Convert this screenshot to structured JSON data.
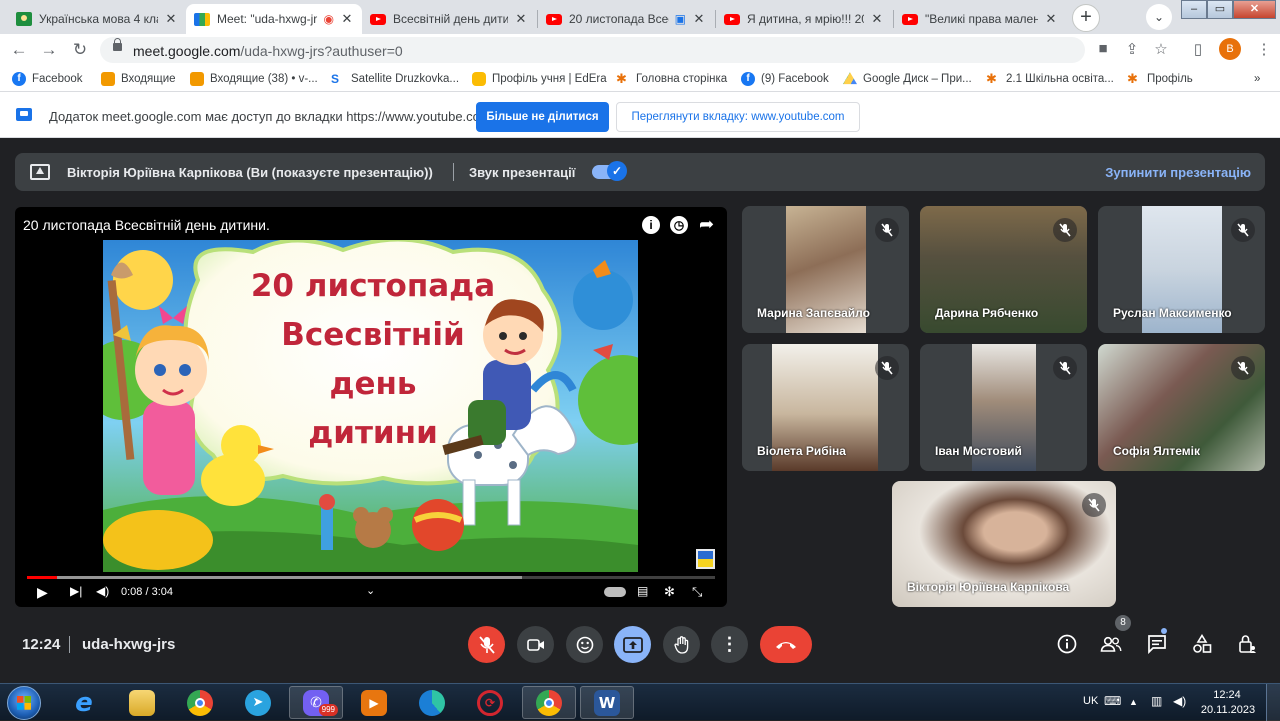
{
  "browser": {
    "tabs": [
      {
        "title": "Українська мова 4 кла",
        "favicon": "classroom-icon",
        "active": false
      },
      {
        "title": "Meet: \"uda-hxwg-jr",
        "favicon": "meet-icon",
        "active": true
      },
      {
        "title": "Всесвітній день дитин",
        "favicon": "youtube-icon",
        "active": false
      },
      {
        "title": "20 листопада Всес",
        "favicon": "youtube-icon",
        "active": false
      },
      {
        "title": "Я дитина, я мрію!!! 20",
        "favicon": "youtube-icon",
        "active": false
      },
      {
        "title": "\"Великі права малень",
        "favicon": "youtube-icon",
        "active": false
      }
    ],
    "new_tab": "+",
    "url_host": "meet.google.com",
    "url_path": "/uda-hxwg-jrs?authuser=0",
    "profile_initial": "B",
    "bookmarks": [
      {
        "label": "Facebook",
        "icon": "facebook-icon"
      },
      {
        "label": "Входящие",
        "icon": "ukrnet-icon"
      },
      {
        "label": "Входящие (38) • v-...",
        "icon": "ukrnet-icon"
      },
      {
        "label": "Satellite Druzkovka...",
        "icon": "satellite-icon"
      },
      {
        "label": "Профіль учня | EdEra",
        "icon": "edera-icon"
      },
      {
        "label": "Головна сторінка",
        "icon": "school-icon"
      },
      {
        "label": "(9) Facebook",
        "icon": "facebook-icon"
      },
      {
        "label": "Google Диск – При...",
        "icon": "drive-icon"
      },
      {
        "label": "2.1 Шкільна освіта...",
        "icon": "school-icon"
      },
      {
        "label": "Профіль",
        "icon": "school-icon"
      }
    ],
    "more_bookmarks": "»"
  },
  "infobar": {
    "message": "Додаток meet.google.com має доступ до вкладки https://www.youtube.com",
    "stop_sharing": "Більше не ділитися",
    "view_tab": "Переглянути вкладку: www.youtube.com"
  },
  "presenting": {
    "presenter": "Вікторія Юріївна Карпікова (Ви (показуєте презентацію))",
    "audio_label": "Звук презентації",
    "audio_on": true,
    "stop_label": "Зупинити презентацію"
  },
  "video": {
    "title": "20 листопада Всесвітній день дитини.",
    "poster_heading": [
      "20 листопада",
      "Всесвітній",
      "день",
      "дитини"
    ],
    "time_current": "0:08",
    "time_total": "3:04",
    "played_fraction": 0.043,
    "buffered_fraction": 0.72
  },
  "participants": [
    {
      "name": "Марина Запєвайло",
      "muted": true
    },
    {
      "name": "Дарина Рябченко",
      "muted": true
    },
    {
      "name": "Руслан Максименко",
      "muted": true
    },
    {
      "name": "Віолета Рибіна",
      "muted": true
    },
    {
      "name": "Іван Мостовий",
      "muted": true
    },
    {
      "name": "Софія Ялтемік",
      "muted": true
    },
    {
      "name": "Вікторія Юріївна Карпікова",
      "muted": true
    }
  ],
  "meeting": {
    "time": "12:24",
    "code": "uda-hxwg-jrs",
    "people_count": "8"
  },
  "taskbar": {
    "apps": [
      {
        "name": "internet-explorer",
        "label": "e"
      },
      {
        "name": "file-explorer",
        "label": ""
      },
      {
        "name": "chrome",
        "label": ""
      },
      {
        "name": "telegram",
        "label": ""
      },
      {
        "name": "viber",
        "label": "",
        "badge": "999"
      },
      {
        "name": "media-player",
        "label": ""
      },
      {
        "name": "edge",
        "label": ""
      },
      {
        "name": "opera-like",
        "label": ""
      },
      {
        "name": "chrome-running",
        "label": ""
      },
      {
        "name": "word",
        "label": "W"
      }
    ],
    "language": "UK",
    "clock_time": "12:24",
    "clock_date": "20.11.2023"
  },
  "colors": {
    "meet_bg": "#202124",
    "meet_tile": "#3c4043",
    "accent_blue": "#1a73e8",
    "meet_red": "#ea4335",
    "present_blue": "#8ab4f8"
  }
}
